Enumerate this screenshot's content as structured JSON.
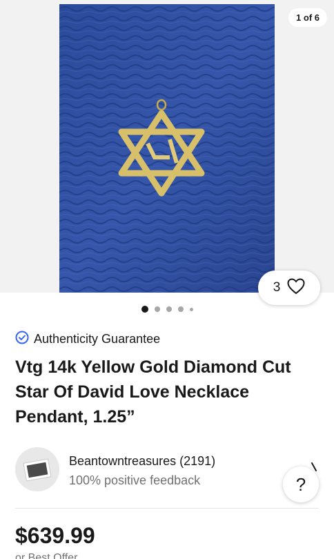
{
  "gallery": {
    "counter": "1 of 6",
    "slide_count": 5,
    "active_slide": 0,
    "background_color": "#2f4fa0",
    "pendant_color": "#d8c06a"
  },
  "watchers": {
    "count": "3",
    "icon": "heart-icon"
  },
  "authenticity": {
    "label": "Authenticity Guarantee",
    "icon": "verified-check-icon",
    "color": "#3665f3"
  },
  "listing": {
    "title": "Vtg 14k Yellow Gold Diamond Cut Star Of David Love Necklace Pendant, 1.25”"
  },
  "seller": {
    "name_with_score": "Beantowntreasures (2191)",
    "feedback": "100% positive feedback"
  },
  "help_button": {
    "label": "?"
  },
  "price": {
    "amount": "$639.99",
    "best_offer": "or Best Offer"
  }
}
